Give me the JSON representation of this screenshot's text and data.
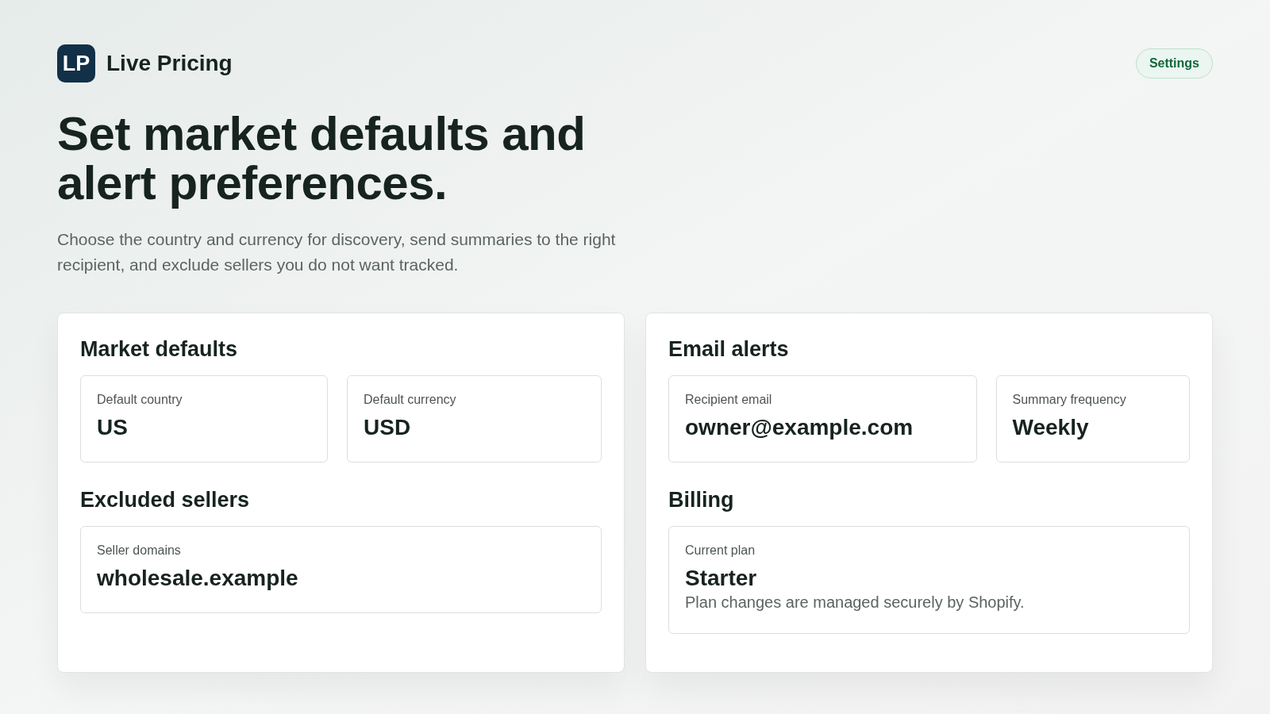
{
  "header": {
    "logo": "LP",
    "app_name": "Live Pricing",
    "settings_button": "Settings"
  },
  "hero": {
    "title": "Set market defaults and alert preferences.",
    "description": "Choose the country and currency for discovery, send summaries to the right recipient, and exclude sellers you do not want tracked."
  },
  "cards": [
    {
      "sections": [
        {
          "heading": "Market defaults",
          "fields": [
            {
              "label": "Default country",
              "value": "US"
            },
            {
              "label": "Default currency",
              "value": "USD"
            }
          ]
        },
        {
          "heading": "Excluded sellers",
          "fields": [
            {
              "label": "Seller domains",
              "value": "wholesale.example"
            }
          ]
        }
      ]
    },
    {
      "sections": [
        {
          "heading": "Email alerts",
          "fields": [
            {
              "label": "Recipient email",
              "value": "owner@example.com"
            },
            {
              "label": "Summary frequency",
              "value": "Weekly"
            }
          ]
        },
        {
          "heading": "Billing",
          "fields": [
            {
              "label": "Current plan",
              "value": "Starter",
              "note": "Plan changes are managed securely by Shopify."
            }
          ]
        }
      ]
    }
  ]
}
